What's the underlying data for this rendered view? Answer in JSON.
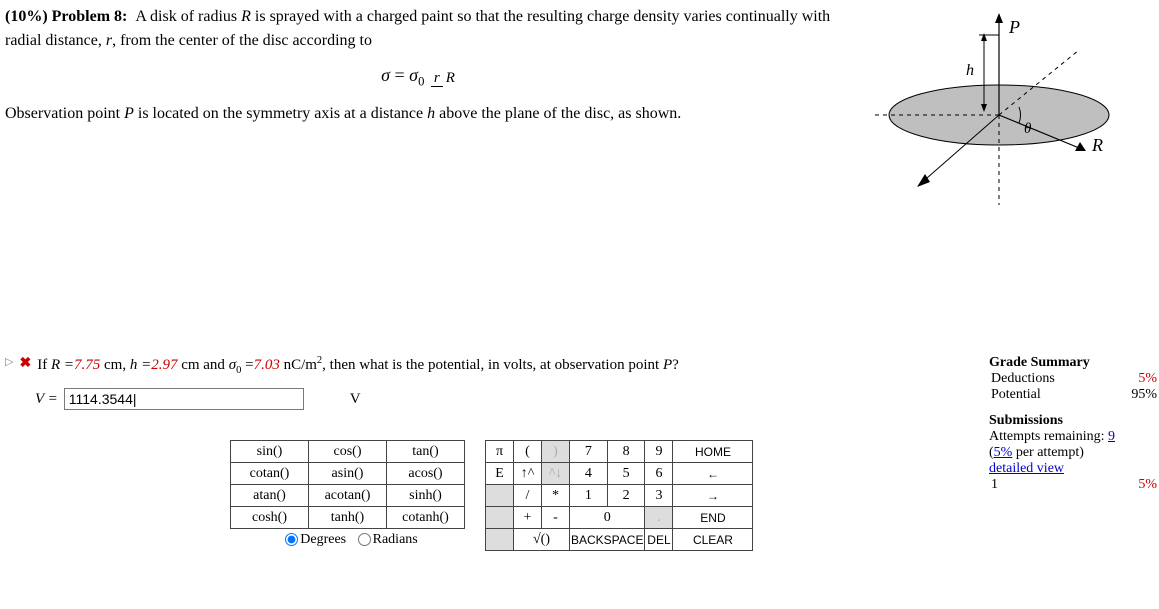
{
  "problem": {
    "weight_label": "(10%)",
    "title": "Problem 8:",
    "line1a": "A disk of radius ",
    "R": "R",
    "line1b": " is sprayed with a charged paint so that the resulting charge density varies continually with radial distance, ",
    "rvar": "r",
    "line1c": ", from the center of the disc according to",
    "eq_sigma": "σ",
    "eq_eq": " = ",
    "eq_s0a": "σ",
    "eq_s0b": "0",
    "eq_num": "r",
    "eq_den": "R",
    "line2a": "Observation point ",
    "Pvar": "P",
    "line2b": " is located on the symmetry axis at a distance ",
    "hvar": "h",
    "line2c": " above the plane of the disc, as shown."
  },
  "figure_labels": {
    "P": "P",
    "h": "h",
    "theta": "θ",
    "R": "R"
  },
  "question": {
    "pre": "If ",
    "R_lhs": "R =",
    "R_val": "7.75",
    "R_unit": " cm, ",
    "h_lhs": "h =",
    "h_val": "2.97",
    "h_unit": " cm and ",
    "s_lhs_a": "σ",
    "s_lhs_b": "0",
    "s_lhs_eq": " =",
    "s_val": "7.03",
    "s_unit_a": " nC/m",
    "s_unit_sup": "2",
    "tail": ", then what is the potential, in volts, at observation point ",
    "P": "P",
    "qmark": "?"
  },
  "answer": {
    "label_lhs": "V = ",
    "value": "1114.3544|",
    "unit": "V"
  },
  "funcpad": {
    "r1c1": "sin()",
    "r1c2": "cos()",
    "r1c3": "tan()",
    "r2c1": "cotan()",
    "r2c2": "asin()",
    "r2c3": "acos()",
    "r3c1": "atan()",
    "r3c2": "acotan()",
    "r3c3": "sinh()",
    "r4c1": "cosh()",
    "r4c2": "tanh()",
    "r4c3": "cotanh()",
    "deg": "Degrees",
    "rad": "Radians"
  },
  "numpad": {
    "r1": [
      "π",
      "(",
      ")",
      "7",
      "8",
      "9",
      "HOME"
    ],
    "r2": [
      "E",
      "↑^",
      "^↓",
      "4",
      "5",
      "6",
      "←"
    ],
    "r3": [
      "",
      "/",
      "*",
      "1",
      "2",
      "3",
      "→"
    ],
    "r4": [
      "",
      "+",
      "-",
      "0",
      ".",
      "",
      "END"
    ],
    "r5": [
      "",
      "√()",
      "BACKSPACE",
      "DEL",
      "CLEAR"
    ]
  },
  "grade": {
    "summary_title": "Grade Summary",
    "ded_label": "Deductions",
    "ded_val": "5%",
    "pot_label": "Potential",
    "pot_val": "95%",
    "sub_title": "Submissions",
    "attempts_a": "Attempts remaining: ",
    "attempts_n": "9",
    "per_a": "(",
    "per_b": "5%",
    "per_c": " per attempt)",
    "detailed": "detailed view",
    "hist_1": "1",
    "hist_1v": "5%"
  }
}
